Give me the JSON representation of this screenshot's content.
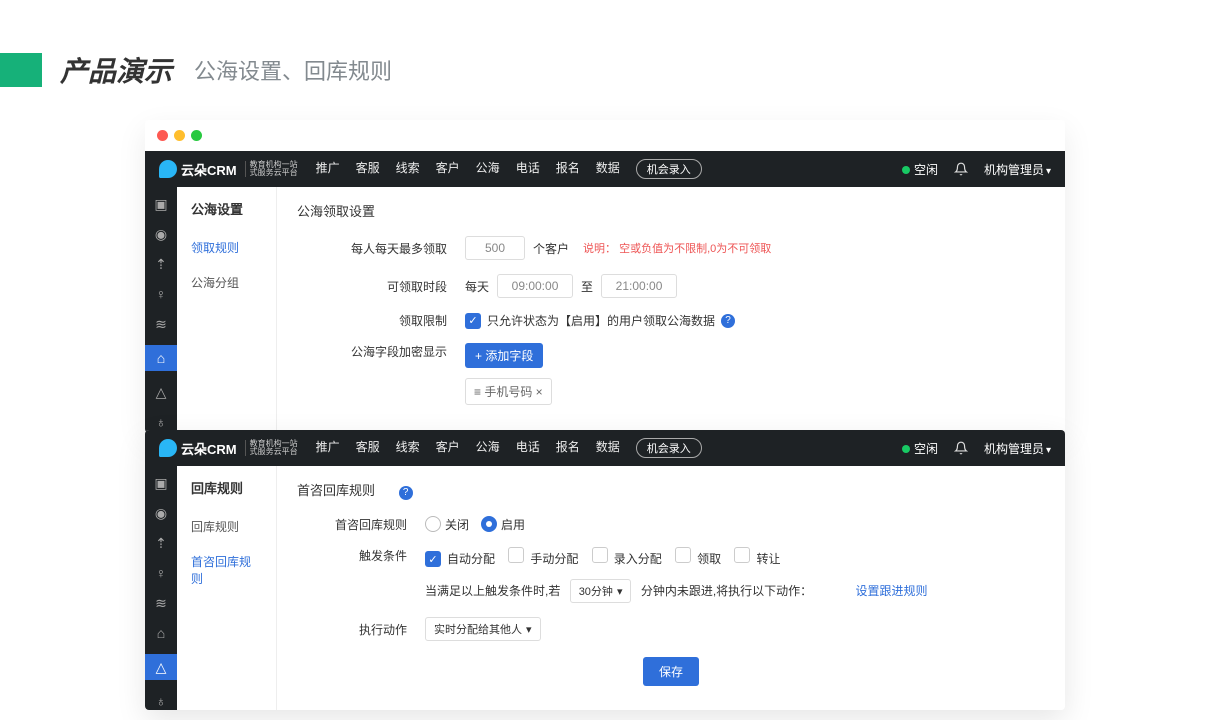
{
  "slide": {
    "title": "产品演示",
    "subtitle": "公海设置、回库规则"
  },
  "nav": {
    "brand": "云朵CRM",
    "brand_sub1": "教育机构一站",
    "brand_sub2": "式服务云平台",
    "items": [
      "推广",
      "客服",
      "线索",
      "客户",
      "公海",
      "电话",
      "报名",
      "数据"
    ],
    "pill": "机会录入",
    "status": "空闲",
    "user": "机构管理员"
  },
  "win1": {
    "sidebar_title": "公海设置",
    "sidebar_items": [
      "领取规则",
      "公海分组"
    ],
    "sidebar_active": 0,
    "section": "公海领取设置",
    "rows": {
      "max_label": "每人每天最多领取",
      "max_value": "500",
      "max_unit": "个客户",
      "max_hint_label": "说明：",
      "max_hint_text": "空或负值为不限制,0为不可领取",
      "time_label": "可领取时段",
      "time_prefix": "每天",
      "time_from": "09:00:00",
      "time_to_label": "至",
      "time_to": "21:00:00",
      "limit_label": "领取限制",
      "limit_check": "只允许状态为【启用】的用户领取公海数据",
      "encrypt_label": "公海字段加密显示",
      "add_field_btn": "+ 添加字段",
      "tag_text": "≡ 手机号码 ×"
    }
  },
  "win2": {
    "sidebar_title": "回库规则",
    "sidebar_items": [
      "回库规则",
      "首咨回库规则"
    ],
    "sidebar_active": 1,
    "section": "首咨回库规则",
    "rows": {
      "rule_label": "首咨回库规则",
      "r_off": "关闭",
      "r_on": "启用",
      "trigger_label": "触发条件",
      "c1": "自动分配",
      "c2": "手动分配",
      "c3": "录入分配",
      "c4": "领取",
      "c5": "转让",
      "cond_text1": "当满足以上触发条件时,若",
      "cond_sel": "30分钟",
      "cond_text2": "分钟内未跟进,将执行以下动作：",
      "cond_link": "设置跟进规则",
      "action_label": "执行动作",
      "action_sel": "实时分配给其他人",
      "save": "保存"
    }
  }
}
